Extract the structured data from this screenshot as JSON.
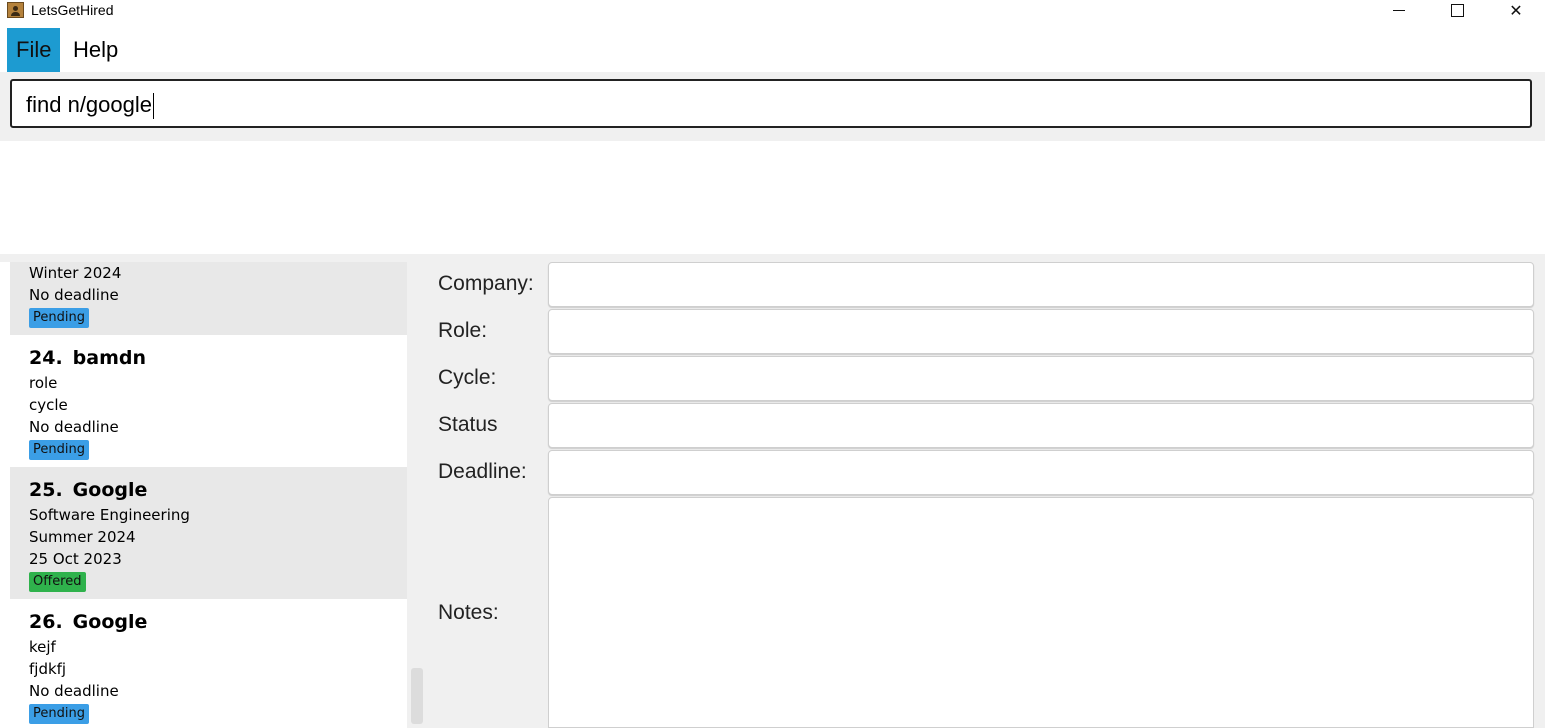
{
  "window": {
    "title": "LetsGetHired",
    "minimize_icon": "minimize-icon",
    "maximize_icon": "maximize-icon",
    "close_icon": "close-icon"
  },
  "menu": {
    "file": "File",
    "help": "Help"
  },
  "command": {
    "value": "find n/google"
  },
  "result": {
    "text": ""
  },
  "list": {
    "partial_card": {
      "cycle": "Winter 2024",
      "deadline": "No deadline",
      "status": "Pending"
    },
    "cards": [
      {
        "index": "24.",
        "company": "bamdn",
        "role": "role",
        "cycle": "cycle",
        "deadline": "No deadline",
        "status": "Pending"
      },
      {
        "index": "25.",
        "company": "Google",
        "role": "Software Engineering",
        "cycle": "Summer 2024",
        "deadline": "25 Oct 2023",
        "status": "Offered"
      },
      {
        "index": "26.",
        "company": "Google",
        "role": "kejf",
        "cycle": "fjdkfj",
        "deadline": "No deadline",
        "status": "Pending"
      }
    ]
  },
  "details": {
    "company_label": "Company:",
    "role_label": "Role:",
    "cycle_label": "Cycle:",
    "status_label": "Status",
    "deadline_label": "Deadline:",
    "notes_label": "Notes:",
    "company_value": "",
    "role_value": "",
    "cycle_value": "",
    "status_value": "",
    "deadline_value": "",
    "notes_value": ""
  },
  "colors": {
    "menu_active": "#1d9bd1",
    "pending": "#3b9ee6",
    "offered": "#2fb24c"
  }
}
